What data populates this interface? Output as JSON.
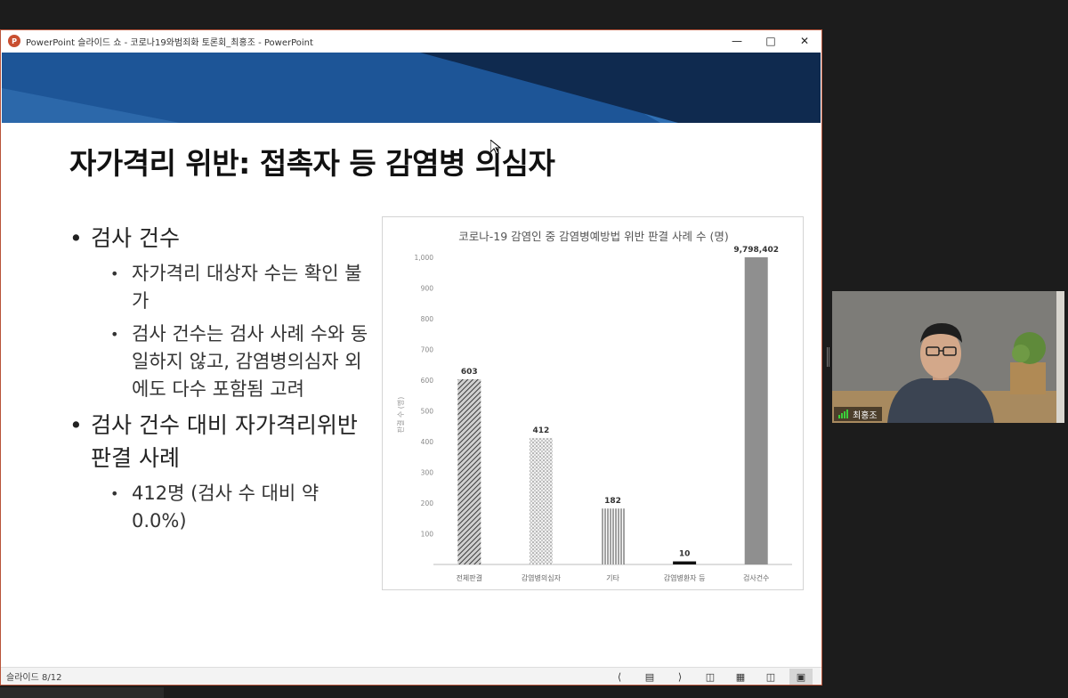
{
  "window": {
    "title": "PowerPoint 슬라이드 쇼  -  코로나19와범죄화 토론회_최홍조 - PowerPoint",
    "minimize_icon": "minimize-icon",
    "maximize_icon": "maximize-icon",
    "close_icon": "close-icon"
  },
  "slide": {
    "title": "자가격리 위반: 접촉자 등 감염병 의심자",
    "bullets": [
      {
        "level": 1,
        "text": "검사 건수"
      },
      {
        "level": 2,
        "text": "자가격리 대상자 수는 확인 불가"
      },
      {
        "level": 2,
        "text": "검사 건수는 검사 사례 수와 동일하지 않고, 감염병의심자 외에도 다수 포함됨 고려"
      },
      {
        "level": 1,
        "text": "검사 건수 대비 자가격리위반 판결 사례"
      },
      {
        "level": 2,
        "text": "412명 (검사 수 대비 약 0.0%)"
      }
    ],
    "colors": {
      "banner_dark": "#0f2a4f",
      "banner_mid": "#1c4c86",
      "banner_light": "#2f6fb3"
    }
  },
  "chart_data": {
    "type": "bar",
    "title": "코로나-19 감염인 중 감염병예방법 위반 판결 사례 수 (명)",
    "ylabel": "판결 수 (명)",
    "xlabel": "",
    "categories": [
      "전체판결",
      "감염병의심자",
      "기타",
      "감염병환자 등",
      "검사건수"
    ],
    "values": [
      603,
      412,
      182,
      10,
      9798402
    ],
    "data_labels": [
      "603",
      "412",
      "182",
      "10",
      "9,798,402"
    ],
    "ylim": [
      0,
      1000
    ],
    "yticks": [
      "",
      "100",
      "200",
      "300",
      "400",
      "500",
      "600",
      "700",
      "800",
      "900",
      "1,000"
    ],
    "patterns": [
      "diagonal-dense",
      "dotted",
      "vertical-lines",
      "solid-black",
      "solid-gray"
    ],
    "grid": false,
    "legend": "none"
  },
  "statusbar": {
    "slide_indicator": "슬라이드 8/12"
  },
  "video": {
    "participant_name": "최홍조"
  }
}
